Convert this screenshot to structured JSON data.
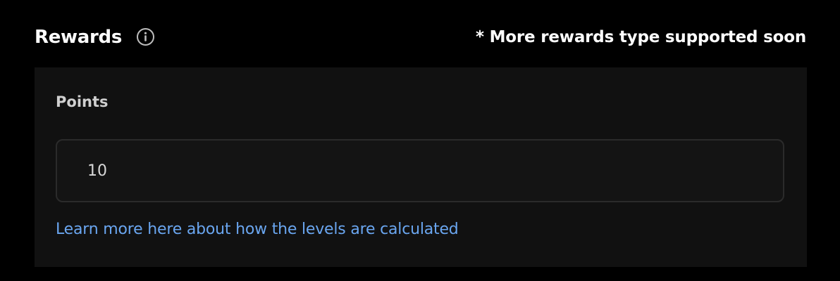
{
  "header": {
    "title": "Rewards",
    "info_icon": "info-circle-icon",
    "note": "* More rewards type supported soon"
  },
  "rewards_panel": {
    "points_label": "Points",
    "points_value": "10",
    "learn_more_link": "Learn more here about how the levels are calculated"
  },
  "colors": {
    "background": "#000000",
    "panel": "#111111",
    "input_border": "#2b2b2b",
    "link": "#6aa6f0",
    "text": "#ffffff"
  }
}
